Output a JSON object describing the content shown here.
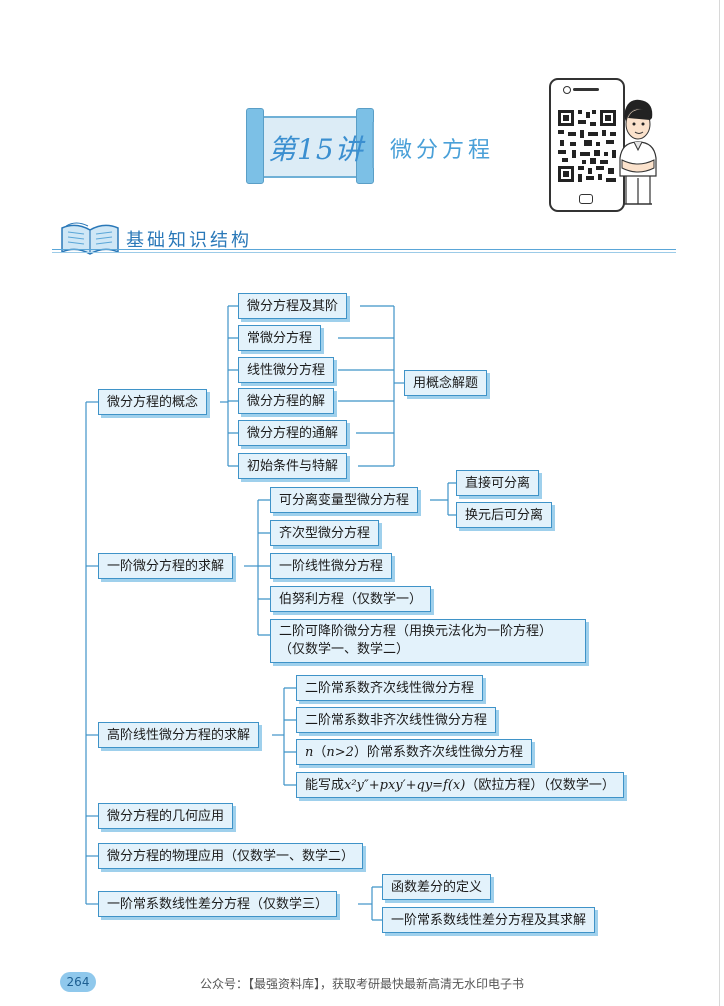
{
  "header": {
    "lecture_number": "第15讲",
    "chapter_title": "微分方程"
  },
  "section": {
    "title": "基础知识结构"
  },
  "mindmap": {
    "concept": {
      "label": "微分方程的概念",
      "items": [
        "微分方程及其阶",
        "常微分方程",
        "线性微分方程",
        "微分方程的解",
        "微分方程的通解",
        "初始条件与特解"
      ],
      "method": "用概念解题"
    },
    "first_order": {
      "label": "一阶微分方程的求解",
      "separable": {
        "label": "可分离变量型微分方程",
        "items": [
          "直接可分离",
          "换元后可分离"
        ]
      },
      "items": [
        "齐次型微分方程",
        "一阶线性微分方程",
        "伯努利方程（仅数学一）"
      ],
      "reducible_line1": "二阶可降阶微分方程（用换元法化为一阶方程）",
      "reducible_line2": "（仅数学一、数学二）"
    },
    "higher_order": {
      "label": "高阶线性微分方程的求解",
      "items": [
        "二阶常系数齐次线性微分方程",
        "二阶常系数非齐次线性微分方程",
        "阶常系数齐次线性微分方程"
      ],
      "nth_prefix_n": "n",
      "nth_paren_open": "（",
      "nth_cond": "n>2",
      "nth_paren_close": "）",
      "euler_prefix": "能写成",
      "euler_formula": "x²y″+pxy′+qy=f(x)",
      "euler_suffix": "（欧拉方程）（仅数学一）"
    },
    "geometry": "微分方程的几何应用",
    "physics": "微分方程的物理应用（仅数学一、数学二）",
    "difference": {
      "label": "一阶常系数线性差分方程（仅数学三）",
      "items": [
        "函数差分的定义",
        "一阶常系数线性差分方程及其求解"
      ]
    }
  },
  "footer": {
    "page_number": "264",
    "watermark": "公众号：【最强资料库】，获取考研最快最新高清无水印电子书"
  },
  "colors": {
    "accent": "#3f93c8",
    "node_fill": "#e3f2fb",
    "title_blue": "#3b8fd0"
  }
}
